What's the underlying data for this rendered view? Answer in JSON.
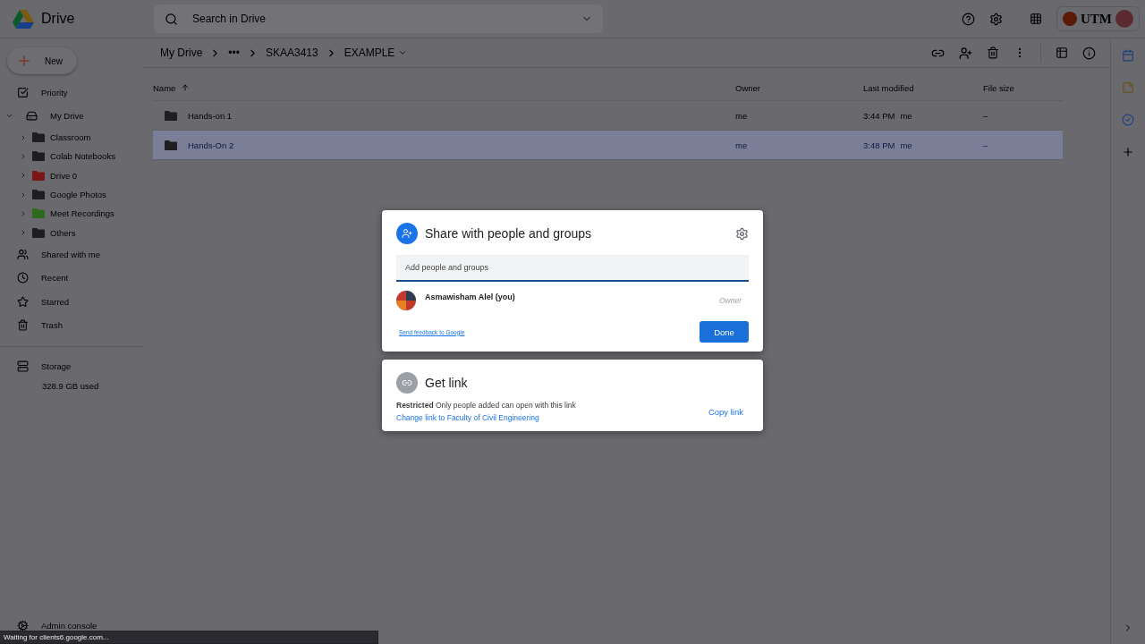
{
  "app": {
    "name": "Drive"
  },
  "search": {
    "placeholder": "Search in Drive"
  },
  "account": {
    "logo_text": "UTM"
  },
  "new_button": {
    "label": "New"
  },
  "sidebar": {
    "items": [
      {
        "label": "Priority"
      },
      {
        "label": "My Drive",
        "expanded": true,
        "children": [
          {
            "label": "Classroom",
            "color": "#1e1e22",
            "expanded": false
          },
          {
            "label": "Colab Notebooks",
            "color": "#1e1e22",
            "expanded": false
          },
          {
            "label": "Drive 0",
            "color": "#7a1616",
            "expanded": false
          },
          {
            "label": "Google Photos",
            "color": "#1e1e22",
            "expanded": false
          },
          {
            "label": "Meet Recordings",
            "color": "#2e6a1c",
            "expanded": false
          },
          {
            "label": "Others",
            "color": "#1e1e22",
            "expanded": false
          }
        ]
      },
      {
        "label": "Shared with me"
      },
      {
        "label": "Recent"
      },
      {
        "label": "Starred"
      },
      {
        "label": "Trash"
      }
    ],
    "storage": {
      "label": "Storage",
      "usage": "328.9 GB used"
    },
    "admin": {
      "label": "Admin console"
    }
  },
  "breadcrumb": [
    "My Drive",
    "•••",
    "SKAA3413",
    "EXAMPLE"
  ],
  "table": {
    "columns": [
      "Name",
      "Owner",
      "Last modified",
      "File size"
    ],
    "rows": [
      {
        "name": "Hands-on 1",
        "owner": "me",
        "modified": "3:44 PM",
        "modified_by": "me",
        "size": "–",
        "selected": false
      },
      {
        "name": "Hands-On 2",
        "owner": "me",
        "modified": "3:48 PM",
        "modified_by": "me",
        "size": "–",
        "selected": true
      }
    ]
  },
  "share_dialog": {
    "title": "Share with people and groups",
    "input_placeholder": "Add people and groups",
    "people": [
      {
        "name": "Asmawisham Alel (you)",
        "role": "Owner"
      }
    ],
    "feedback_link": "Send feedback to Google",
    "done_button": "Done"
  },
  "link_dialog": {
    "title": "Get link",
    "access": "Restricted",
    "description": "Only people added can open with this link",
    "change_link": "Change link to Faculty of Civil Engineering",
    "copy_button": "Copy link"
  },
  "status_bar": "Waiting for clients6.google.com..."
}
